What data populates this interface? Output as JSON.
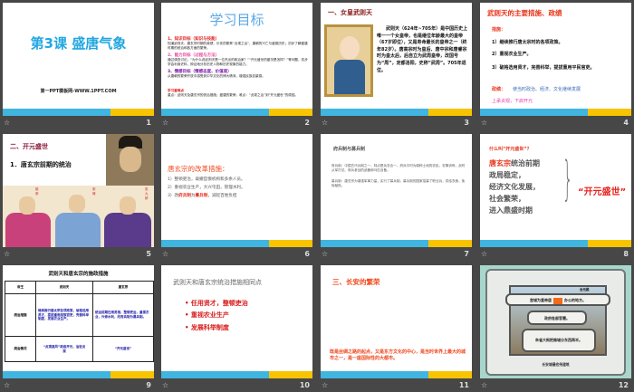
{
  "transition_icon": "☆",
  "slides": [
    {
      "number": "1",
      "title": "第3课 盛唐气象",
      "subtitle": "第一PPT模板网-WWW.1PPT.COM"
    },
    {
      "number": "2",
      "title": "学习目标",
      "h1": "1、知识目标（知识与技能）",
      "p1": "知道武则天、唐玄宗时期的政绩，长安的繁荣“贞观之治”，唐朝的兴亡与盛衰历史；初步了解盛唐时期的统治和各方面的繁荣。",
      "h2": "2、能力目标（过程与方法）",
      "p2": "通过调查讨论，“为什么说武则天是一位杰出的政治家？”“开元盛世的盛况是怎样？”等问题，初步学会利用史料，辩证地分析历史人物和历史现象的能力。",
      "h3": "3、情感目标（情感态度、价值观）",
      "p3": "从唐朝的繁荣开放中感受到中华文化的博大精深，增强民族自豪感。",
      "h4": "学习重难点",
      "p4": "重点：武则天及唐玄宗的统治措施；盛唐的繁荣。难点：“贞观之治”到“开元盛世”的原因。"
    },
    {
      "number": "3",
      "title": "一、女皇武则天",
      "body": "武则天（624年~705年）是中国历史上唯一一个女皇帝，也是继位年龄最大的皇帝（67岁即位），又是寿命最长的皇帝之一（终年82岁）。唐高宗时为皇后、唐中宗和唐睿宗时为皇太后，后自立为武周皇帝，改国号为“周”，定都洛阳，史称“武周”。705年退位。"
    },
    {
      "number": "4",
      "title": "武则天的主要措施、政绩",
      "measures_label": "措施：",
      "items": [
        "1）继续推行唐太宗时的各项政策。",
        "2）重视农业生产。",
        "3）破格选用贤才，完善科举，提拔重用平民官吏。"
      ],
      "result_label": "政绩：",
      "result": "使当时政治、经济、文化继续发展",
      "result2": "上承贞观，下启开元"
    },
    {
      "number": "5",
      "title": "二、开元盛世",
      "subtitle": "1．唐玄宗前期的统治",
      "names": [
        "姚崇",
        "宋璟",
        "张九龄"
      ]
    },
    {
      "number": "6",
      "title": "唐玄宗的改革措施：",
      "items": [
        "1）整顿吏治，裁撤官僚机构和多余人员。",
        "2）重视农业生产，大兴屯田，管理水利。"
      ],
      "item3_a": "3）改",
      "item3_b": "府兵制",
      "item3_c": "为",
      "item3_d": "募兵制",
      "item3_e": "，减轻百姓负担"
    },
    {
      "number": "7",
      "title": "府兵制与募兵制",
      "bullets": [
        "府兵制：中国古代兵制之一，特点是兵农合一，府兵平时为耕种土地的农民，农隙训练，战时从军打仗。府兵参战的武器和马匹自备。",
        "募兵制：唐玄宗为增强军事力量，实行了募兵制。募兵制的国家招募了职业兵，供给衣食，免除赋役。"
      ]
    },
    {
      "number": "8",
      "question": "什么叫“开元盛世”？",
      "lines_a": "唐玄宗",
      "lines": [
        "统治前期",
        "政局稳定，",
        "经济文化发展，",
        "社会繁荣，",
        "进入鼎盛时期"
      ],
      "label": "“开元盛世”"
    },
    {
      "number": "9",
      "title": "武则天和唐玄宗的施政措施",
      "headers": [
        "帝王",
        "武则天",
        "唐玄宗"
      ],
      "rows": [
        [
          "统治措施",
          "继续推行唐太宗各项政策，破格选用贤才，提拔重用庶族官吏，完善科举制度，发展农业生产。",
          "统治前期任用贤相，整顿吏治，重视农业，兴修水利，改府兵制为募兵制。"
        ],
        [
          "统治情况",
          "“贞观遗风”政启开元，治宏贞观",
          "“开元盛世”"
        ]
      ]
    },
    {
      "number": "10",
      "title": "武则天和唐玄宗统治措施相同点",
      "bullets": [
        "任用贤才，整顿吏治",
        "重视农业生产",
        "发展科举制度"
      ]
    },
    {
      "number": "11",
      "title": "三、长安的繁荣",
      "body": "既是丝绸之路的起点，又是东方文化的中心，是当时世界上最大的城市之一，是一座国际性的大都市。"
    },
    {
      "number": "12",
      "tag": "含元殿",
      "box1_a": "宫城为皇帝居",
      "box1_b": "办公的地方。",
      "box2": "政府各部官署。",
      "box3": "朱雀大街把南城分东西两半。",
      "caption": "长安城最宏伟建筑"
    }
  ]
}
